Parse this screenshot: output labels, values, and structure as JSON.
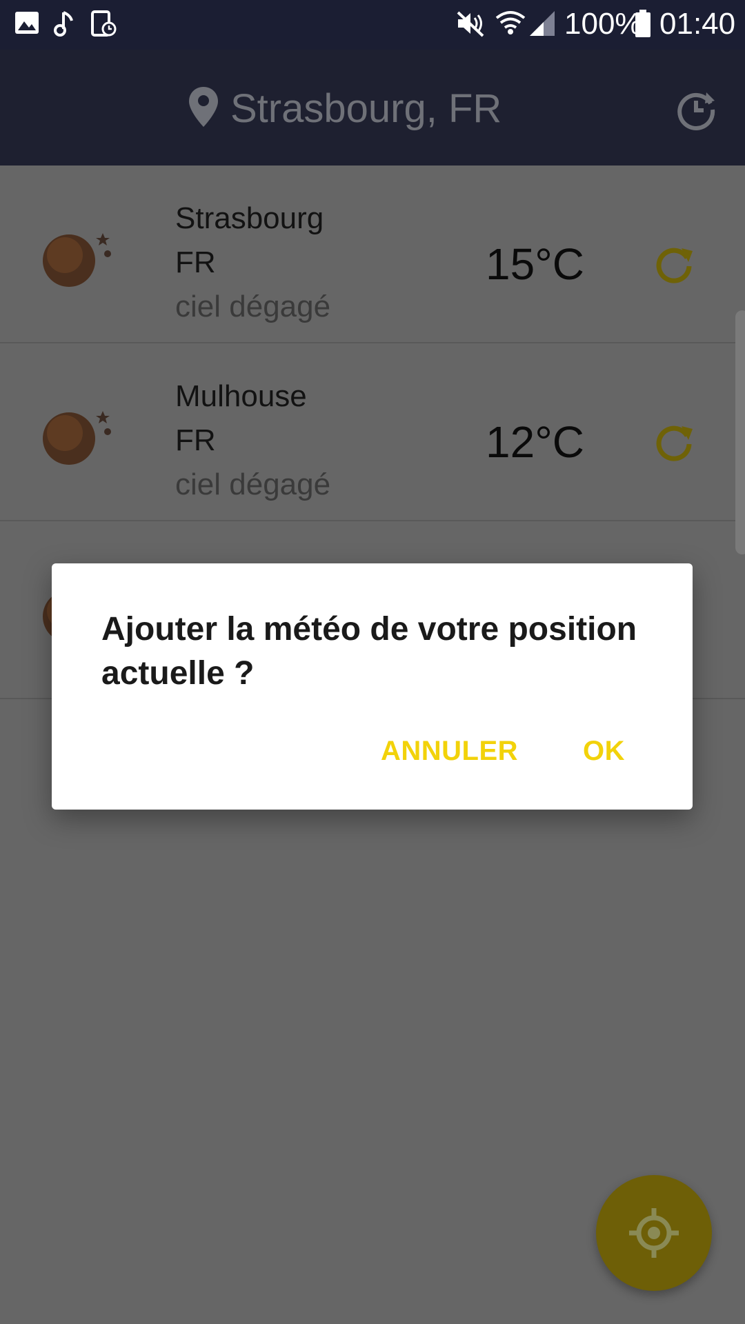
{
  "status_bar": {
    "battery": "100%",
    "time": "01:40",
    "icons": [
      "image-icon",
      "music-note-icon",
      "screen-timer-icon",
      "mute-icon",
      "wifi-icon",
      "signal-icon",
      "battery-icon"
    ]
  },
  "toolbar": {
    "location": "Strasbourg, FR",
    "icons": [
      "location-pin-icon",
      "history-icon"
    ]
  },
  "cities": [
    {
      "city": "Strasbourg",
      "country": "FR",
      "description": "ciel dégagé",
      "temperature": "15°C"
    },
    {
      "city": "Mulhouse",
      "country": "FR",
      "description": "ciel dégagé",
      "temperature": "12°C"
    }
  ],
  "dialog": {
    "title": "Ajouter la météo de votre position actuelle ?",
    "cancel_label": "ANNULER",
    "ok_label": "OK"
  },
  "colors": {
    "status_bar": "#1b1e33",
    "toolbar": "#1e2030",
    "accent": "#f2d20a",
    "scrim": "#666666"
  }
}
